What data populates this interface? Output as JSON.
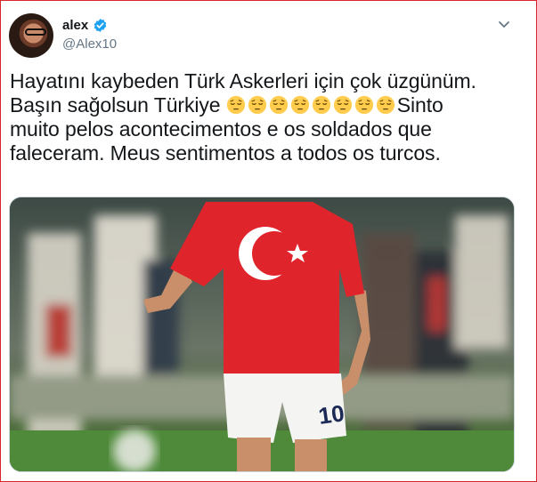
{
  "tweet": {
    "display_name": "alex",
    "handle": "@Alex10",
    "text_line1": "Hayatını kaybeden Türk Askerleri için çok üzgünüm.",
    "text_line2_start": "Başın sağolsun Türkiye ",
    "text_line2_end": "Sinto",
    "text_line3": "muito pelos acontecimentos e os soldados que",
    "text_line4": "faleceram. Meus sentimentos a todos os turcos.",
    "emoji_count": 8,
    "emoji_name": "pensive-face"
  },
  "media": {
    "jersey_number": "10",
    "description_icon": "player-photo"
  },
  "colors": {
    "verified": "#1da1f2",
    "jersey_red": "#e0242b",
    "frame_border": "#d9262a"
  }
}
